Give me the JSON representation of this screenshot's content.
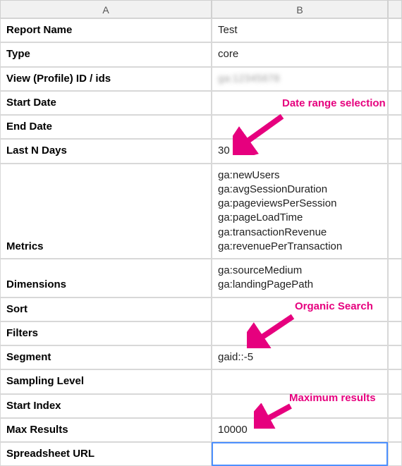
{
  "columns": {
    "A": "A",
    "B": "B"
  },
  "rows": [
    {
      "label": "Report Name",
      "value": "Test"
    },
    {
      "label": "Type",
      "value": "core"
    },
    {
      "label": "View (Profile) ID / ids",
      "value": "ga:12345678",
      "blurred": true
    },
    {
      "label": "Start Date",
      "value": ""
    },
    {
      "label": "End Date",
      "value": ""
    },
    {
      "label": "Last N Days",
      "value": "30"
    },
    {
      "label": "Metrics",
      "value": "ga:newUsers\nga:avgSessionDuration\nga:pageviewsPerSession\nga:pageLoadTime\nga:transactionRevenue\nga:revenuePerTransaction"
    },
    {
      "label": "Dimensions",
      "value": "ga:sourceMedium\nga:landingPagePath"
    },
    {
      "label": "Sort",
      "value": ""
    },
    {
      "label": "Filters",
      "value": ""
    },
    {
      "label": "Segment",
      "value": "gaid::-5"
    },
    {
      "label": "Sampling Level",
      "value": ""
    },
    {
      "label": "Start Index",
      "value": ""
    },
    {
      "label": "Max Results",
      "value": "10000"
    },
    {
      "label": "Spreadsheet URL",
      "value": "",
      "selected": true
    }
  ],
  "annotations": {
    "dateRange": "Date range selection",
    "organicSearch": "Organic Search",
    "maxResults": "Maximum results"
  }
}
